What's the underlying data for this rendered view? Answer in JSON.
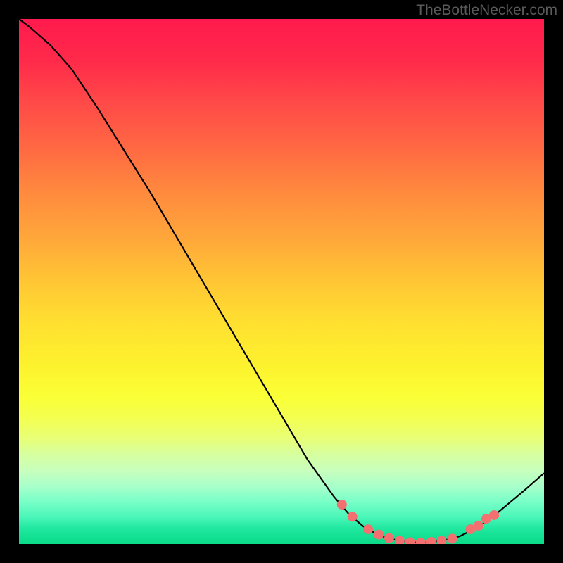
{
  "watermark": "TheBottleNecker.com",
  "chart_data": {
    "type": "line",
    "title": "",
    "xlabel": "",
    "ylabel": "",
    "xlim": [
      0,
      100
    ],
    "ylim": [
      0,
      100
    ],
    "curve": [
      {
        "x": 0,
        "y": 100
      },
      {
        "x": 2,
        "y": 98.5
      },
      {
        "x": 6,
        "y": 95
      },
      {
        "x": 10,
        "y": 90.5
      },
      {
        "x": 15,
        "y": 83
      },
      {
        "x": 20,
        "y": 75
      },
      {
        "x": 25,
        "y": 67
      },
      {
        "x": 30,
        "y": 58.5
      },
      {
        "x": 35,
        "y": 50
      },
      {
        "x": 40,
        "y": 41.5
      },
      {
        "x": 45,
        "y": 33
      },
      {
        "x": 50,
        "y": 24.5
      },
      {
        "x": 55,
        "y": 16
      },
      {
        "x": 60,
        "y": 9
      },
      {
        "x": 63,
        "y": 5.5
      },
      {
        "x": 66,
        "y": 3
      },
      {
        "x": 69,
        "y": 1.5
      },
      {
        "x": 72,
        "y": 0.7
      },
      {
        "x": 75,
        "y": 0.3
      },
      {
        "x": 78,
        "y": 0.3
      },
      {
        "x": 81,
        "y": 0.7
      },
      {
        "x": 84,
        "y": 1.5
      },
      {
        "x": 87,
        "y": 3
      },
      {
        "x": 90,
        "y": 5
      },
      {
        "x": 93,
        "y": 7.5
      },
      {
        "x": 96,
        "y": 10
      },
      {
        "x": 100,
        "y": 13.5
      }
    ],
    "markers": [
      {
        "x": 61.5,
        "y": 7.5
      },
      {
        "x": 63.5,
        "y": 5.2
      },
      {
        "x": 66.5,
        "y": 2.8
      },
      {
        "x": 68.5,
        "y": 1.8
      },
      {
        "x": 70.5,
        "y": 1.1
      },
      {
        "x": 72.5,
        "y": 0.6
      },
      {
        "x": 74.5,
        "y": 0.35
      },
      {
        "x": 76.5,
        "y": 0.3
      },
      {
        "x": 78.5,
        "y": 0.4
      },
      {
        "x": 80.5,
        "y": 0.6
      },
      {
        "x": 82.5,
        "y": 1.0
      },
      {
        "x": 86.0,
        "y": 2.8
      },
      {
        "x": 87.5,
        "y": 3.5
      },
      {
        "x": 89.0,
        "y": 4.8
      },
      {
        "x": 90.5,
        "y": 5.5
      }
    ],
    "marker_color": "#f27070",
    "curve_color": "#000000"
  }
}
